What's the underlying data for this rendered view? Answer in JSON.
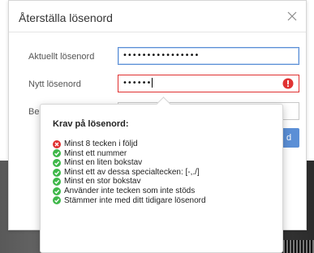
{
  "dialog": {
    "title": "Återställa lösenord",
    "close_icon": "close-icon"
  },
  "form": {
    "current_password": {
      "label": "Aktuellt lösenord",
      "value": "••••••••••••••••"
    },
    "new_password": {
      "label": "Nytt lösenord",
      "value": "••••••",
      "state": "error"
    },
    "confirm_password": {
      "label": "Bel",
      "value": ""
    },
    "submit_fragment": "d"
  },
  "requirements": {
    "title": "Krav på lösenord:",
    "items": [
      {
        "text": "Minst 8 tecken i följd",
        "status": "fail"
      },
      {
        "text": "Minst ett nummer",
        "status": "pass"
      },
      {
        "text": "Minst en liten bokstav",
        "status": "pass"
      },
      {
        "text": "Minst ett av dessa specialtecken: [-,./]",
        "status": "pass"
      },
      {
        "text": "Minst en stor bokstav",
        "status": "pass"
      },
      {
        "text": "Använder inte tecken som inte stöds",
        "status": "pass"
      },
      {
        "text": "Stämmer inte med ditt tidigare lösenord",
        "status": "pass"
      }
    ]
  },
  "colors": {
    "pass": "#3fb84a",
    "fail": "#e03131",
    "accent": "#5b8fd6"
  }
}
